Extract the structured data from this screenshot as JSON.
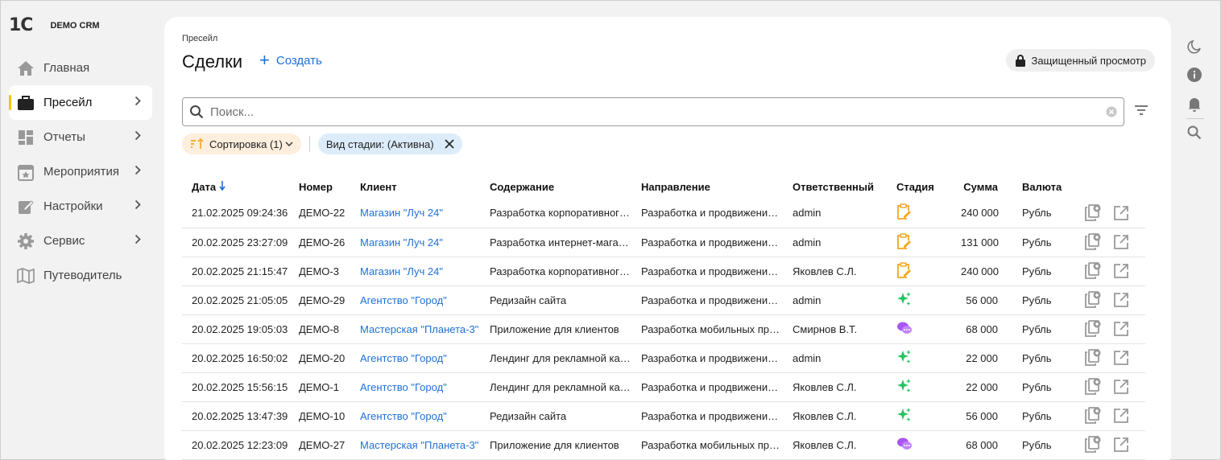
{
  "app": {
    "logo": "1С",
    "name": "DEMO CRM"
  },
  "sidebar": {
    "items": [
      {
        "label": "Главная",
        "icon": "home-icon",
        "active": false,
        "has_children": false
      },
      {
        "label": "Пресейл",
        "icon": "briefcase-icon",
        "active": true,
        "has_children": true
      },
      {
        "label": "Отчеты",
        "icon": "dashboard-icon",
        "active": false,
        "has_children": true
      },
      {
        "label": "Мероприятия",
        "icon": "calendar-star-icon",
        "active": false,
        "has_children": true
      },
      {
        "label": "Настройки",
        "icon": "edit-icon",
        "active": false,
        "has_children": true
      },
      {
        "label": "Сервис",
        "icon": "gear-icon",
        "active": false,
        "has_children": true
      },
      {
        "label": "Путеводитель",
        "icon": "book-icon",
        "active": false,
        "has_children": false
      }
    ]
  },
  "header": {
    "breadcrumb": "Пресейл",
    "title": "Сделки",
    "create_label": "Создать",
    "protected_label": "Защищенный просмотр"
  },
  "search": {
    "placeholder": "Поиск...",
    "value": ""
  },
  "chips": {
    "sort_label": "Сортировка (1)",
    "stage_label": "Вид стадии: (Активна)"
  },
  "table": {
    "columns": [
      "Дата",
      "Номер",
      "Клиент",
      "Содержание",
      "Направление",
      "Ответственный",
      "Стадия",
      "Сумма",
      "Валюта"
    ],
    "sort_column": "Дата",
    "sort_direction": "desc",
    "rows": [
      {
        "date": "21.02.2025 09:24:36",
        "number": "ДЕМО-22",
        "client": "Магазин \"Луч 24\"",
        "content": "Разработка корпоративног…",
        "direction": "Разработка и продвижени…",
        "owner": "admin",
        "stage": "clipboard-edit-icon",
        "amount": "240 000",
        "currency": "Рубль"
      },
      {
        "date": "20.02.2025 23:27:09",
        "number": "ДЕМО-26",
        "client": "Магазин \"Луч 24\"",
        "content": "Разработка интернет-мага…",
        "direction": "Разработка и продвижени…",
        "owner": "admin",
        "stage": "clipboard-edit-icon",
        "amount": "131 000",
        "currency": "Рубль"
      },
      {
        "date": "20.02.2025 21:15:47",
        "number": "ДЕМО-3",
        "client": "Магазин \"Луч 24\"",
        "content": "Разработка корпоративног…",
        "direction": "Разработка и продвижени…",
        "owner": "Яковлев С.Л.",
        "stage": "clipboard-edit-icon",
        "amount": "240 000",
        "currency": "Рубль"
      },
      {
        "date": "20.02.2025 21:05:05",
        "number": "ДЕМО-29",
        "client": "Агентство \"Город\"",
        "content": "Редизайн сайта",
        "direction": "Разработка и продвижени…",
        "owner": "admin",
        "stage": "sparkles-icon",
        "amount": "56 000",
        "currency": "Рубль"
      },
      {
        "date": "20.02.2025 19:05:03",
        "number": "ДЕМО-8",
        "client": "Мастерская \"Планета-3\"",
        "content": "Приложение для клиентов",
        "direction": "Разработка мобильных пр…",
        "owner": "Смирнов В.Т.",
        "stage": "chat-bubbles-icon",
        "amount": "68 000",
        "currency": "Рубль"
      },
      {
        "date": "20.02.2025 16:50:02",
        "number": "ДЕМО-20",
        "client": "Агентство \"Город\"",
        "content": "Лендинг для рекламной ка…",
        "direction": "Разработка и продвижени…",
        "owner": "admin",
        "stage": "sparkles-icon",
        "amount": "22 000",
        "currency": "Рубль"
      },
      {
        "date": "20.02.2025 15:56:15",
        "number": "ДЕМО-1",
        "client": "Агентство \"Город\"",
        "content": "Лендинг для рекламной ка…",
        "direction": "Разработка и продвижени…",
        "owner": "Яковлев С.Л.",
        "stage": "sparkles-icon",
        "amount": "22 000",
        "currency": "Рубль"
      },
      {
        "date": "20.02.2025 13:47:39",
        "number": "ДЕМО-10",
        "client": "Агентство \"Город\"",
        "content": "Редизайн сайта",
        "direction": "Разработка и продвижени…",
        "owner": "Яковлев С.Л.",
        "stage": "sparkles-icon",
        "amount": "56 000",
        "currency": "Рубль"
      },
      {
        "date": "20.02.2025 12:23:09",
        "number": "ДЕМО-27",
        "client": "Мастерская \"Планета-3\"",
        "content": "Приложение для клиентов",
        "direction": "Разработка мобильных пр…",
        "owner": "Яковлев С.Л.",
        "stage": "chat-bubbles-icon",
        "amount": "68 000",
        "currency": "Рубль"
      }
    ]
  },
  "rightbar": {
    "icons": [
      "moon-icon",
      "info-icon",
      "bell-icon",
      "search-icon"
    ]
  },
  "colors": {
    "accent": "#1e6fd9",
    "active_marker": "#f5c400",
    "sort_chip": "#fdeedd",
    "stage_chip": "#dcecfa",
    "stage_orange": "#f5a623",
    "stage_green": "#22c55e",
    "stage_purple": "#a855f7"
  }
}
